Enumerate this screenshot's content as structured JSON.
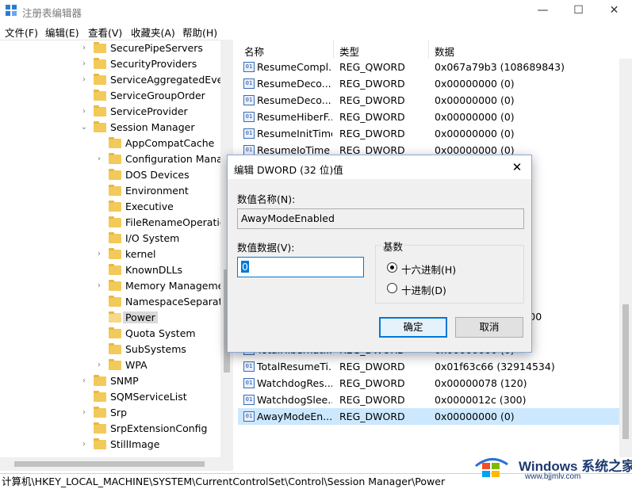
{
  "window": {
    "title": "注册表编辑器",
    "minimize": "—",
    "maximize": "☐",
    "close": "✕"
  },
  "menu": [
    "文件(F)",
    "编辑(E)",
    "查看(V)",
    "收藏夹(A)",
    "帮助(H)"
  ],
  "tree": [
    {
      "label": "SecurePipeServers",
      "level": 0,
      "exp": "›"
    },
    {
      "label": "SecurityProviders",
      "level": 0,
      "exp": "›"
    },
    {
      "label": "ServiceAggregatedEvents",
      "level": 0,
      "exp": "›"
    },
    {
      "label": "ServiceGroupOrder",
      "level": 0,
      "exp": ""
    },
    {
      "label": "ServiceProvider",
      "level": 0,
      "exp": "›"
    },
    {
      "label": "Session Manager",
      "level": 0,
      "exp": "⌄"
    },
    {
      "label": "AppCompatCache",
      "level": 1,
      "exp": ""
    },
    {
      "label": "Configuration Manager",
      "level": 1,
      "exp": "›"
    },
    {
      "label": "DOS Devices",
      "level": 1,
      "exp": ""
    },
    {
      "label": "Environment",
      "level": 1,
      "exp": ""
    },
    {
      "label": "Executive",
      "level": 1,
      "exp": ""
    },
    {
      "label": "FileRenameOperations",
      "level": 1,
      "exp": ""
    },
    {
      "label": "I/O System",
      "level": 1,
      "exp": ""
    },
    {
      "label": "kernel",
      "level": 1,
      "exp": "›"
    },
    {
      "label": "KnownDLLs",
      "level": 1,
      "exp": ""
    },
    {
      "label": "Memory Management",
      "level": 1,
      "exp": "›"
    },
    {
      "label": "NamespaceSeparation",
      "level": 1,
      "exp": ""
    },
    {
      "label": "Power",
      "level": 1,
      "exp": "",
      "selected": true
    },
    {
      "label": "Quota System",
      "level": 1,
      "exp": ""
    },
    {
      "label": "SubSystems",
      "level": 1,
      "exp": ""
    },
    {
      "label": "WPA",
      "level": 1,
      "exp": "›"
    },
    {
      "label": "SNMP",
      "level": 0,
      "exp": "›"
    },
    {
      "label": "SQMServiceList",
      "level": 0,
      "exp": ""
    },
    {
      "label": "Srp",
      "level": 0,
      "exp": "›"
    },
    {
      "label": "SrpExtensionConfig",
      "level": 0,
      "exp": ""
    },
    {
      "label": "StillImage",
      "level": 0,
      "exp": "›"
    }
  ],
  "list": {
    "headers": {
      "name": "名称",
      "type": "类型",
      "data": "数据"
    },
    "rows": [
      {
        "name": "ResumeCompl...",
        "type": "REG_QWORD",
        "data": "0x067a79b3 (108689843)"
      },
      {
        "name": "ResumeDeco...",
        "type": "REG_DWORD",
        "data": "0x00000000 (0)"
      },
      {
        "name": "ResumeDeco...",
        "type": "REG_DWORD",
        "data": "0x00000000 (0)"
      },
      {
        "name": "ResumeHiberF...",
        "type": "REG_DWORD",
        "data": "0x00000000 (0)"
      },
      {
        "name": "ResumeInitTime",
        "type": "REG_DWORD",
        "data": "0x00000000 (0)"
      },
      {
        "name": "ResumeIoTime",
        "type": "REG_DWORD",
        "data": "0x00000000 (0)"
      },
      {
        "name": "",
        "type": "",
        "data": ""
      },
      {
        "name": "",
        "type": "",
        "data": ""
      },
      {
        "name": "",
        "type": "",
        "data": ""
      },
      {
        "name": "",
        "type": "",
        "data": ""
      },
      {
        "name": "",
        "type": "",
        "data": ""
      },
      {
        "name": "",
        "type": "",
        "data": ""
      },
      {
        "name": "",
        "type": "",
        "data": ""
      },
      {
        "name": "",
        "type": "",
        "data": ""
      },
      {
        "name": "",
        "type": "",
        "data": "0)"
      },
      {
        "name": "",
        "type": "",
        "data": "00 00 00 00 00 00 00"
      },
      {
        "name": "",
        "type": "",
        "data": ""
      },
      {
        "name": "TotalHibernat...",
        "type": "REG_DWORD",
        "data": "0x00000000 (0)"
      },
      {
        "name": "TotalResumeTi...",
        "type": "REG_DWORD",
        "data": "0x01f63c66 (32914534)"
      },
      {
        "name": "WatchdogRes...",
        "type": "REG_DWORD",
        "data": "0x00000078 (120)"
      },
      {
        "name": "WatchdogSlee...",
        "type": "REG_DWORD",
        "data": "0x0000012c (300)"
      },
      {
        "name": "AwayModeEn...",
        "type": "REG_DWORD",
        "data": "0x00000000 (0)",
        "selected": true
      }
    ]
  },
  "status_path": "计算机\\HKEY_LOCAL_MACHINE\\SYSTEM\\CurrentControlSet\\Control\\Session Manager\\Power",
  "dialog": {
    "title": "编辑 DWORD (32 位)值",
    "close": "✕",
    "name_label": "数值名称(N):",
    "name_value": "AwayModeEnabled",
    "data_label": "数值数据(V):",
    "data_value": "0",
    "base_label": "基数",
    "radio_hex": "十六进制(H)",
    "radio_dec": "十进制(D)",
    "radio_selected": "hex",
    "ok": "确定",
    "cancel": "取消"
  },
  "watermark": {
    "brand": "Windows",
    "brand_cn": "系统之家",
    "url": "www.bjjmlv.com"
  }
}
